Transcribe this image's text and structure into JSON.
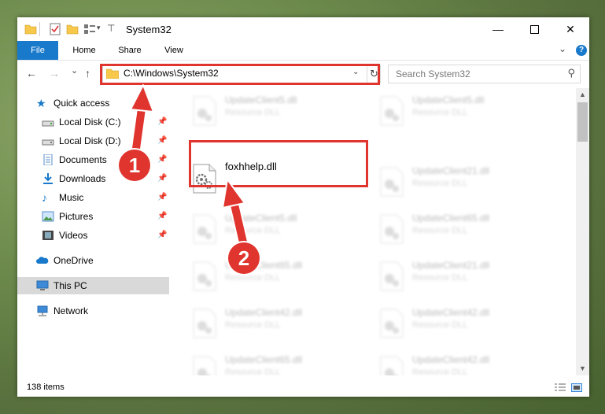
{
  "window": {
    "title": "System32"
  },
  "ribbon": {
    "tabs": [
      "File",
      "Home",
      "Share",
      "View"
    ],
    "help": "?"
  },
  "nav": {
    "back": "←",
    "forward": "→",
    "recent": "⌄",
    "up": "↑",
    "address": "C:\\Windows\\System32",
    "search_placeholder": "Search System32"
  },
  "sidebar": {
    "items": [
      {
        "label": "Quick access",
        "icon": "star-icon"
      },
      {
        "label": "Local Disk (C:)",
        "icon": "drive-icon"
      },
      {
        "label": "Local Disk (D:)",
        "icon": "drive-icon"
      },
      {
        "label": "Documents",
        "icon": "documents-icon"
      },
      {
        "label": "Downloads",
        "icon": "download-icon"
      },
      {
        "label": "Music",
        "icon": "music-icon"
      },
      {
        "label": "Pictures",
        "icon": "pictures-icon"
      },
      {
        "label": "Videos",
        "icon": "videos-icon"
      },
      {
        "label": "OneDrive",
        "icon": "cloud-icon"
      },
      {
        "label": "This PC",
        "icon": "computer-icon"
      },
      {
        "label": "Network",
        "icon": "network-icon"
      }
    ]
  },
  "files": [
    {
      "name": "UpdateClient5.dll",
      "type": "Resource DLL"
    },
    {
      "name": "UpdateClient5.dll",
      "type": "Resource DLL"
    },
    {
      "name": "foxhhelp.dll",
      "type": ""
    },
    {
      "name": "UpdateClient21.dll",
      "type": "Resource DLL"
    },
    {
      "name": "UpdateClient5.dll",
      "type": "Resource DLL"
    },
    {
      "name": "UpdateClient65.dll",
      "type": "Resource DLL"
    },
    {
      "name": "UpdateClient65.dll",
      "type": "Resource DLL"
    },
    {
      "name": "UpdateClient21.dll",
      "type": "Resource DLL"
    },
    {
      "name": "UpdateClient42.dll",
      "type": "Resource DLL"
    },
    {
      "name": "UpdateClient42.dll",
      "type": "Resource DLL"
    },
    {
      "name": "UpdateClient65.dll",
      "type": "Resource DLL"
    },
    {
      "name": "UpdateClient42.dll",
      "type": "Resource DLL"
    }
  ],
  "status": {
    "items": "138 items"
  },
  "annotations": {
    "step1": "1",
    "step2": "2"
  },
  "colors": {
    "accent": "#1979ca",
    "annotation": "#e0342e",
    "folder": "#f8c84a"
  }
}
